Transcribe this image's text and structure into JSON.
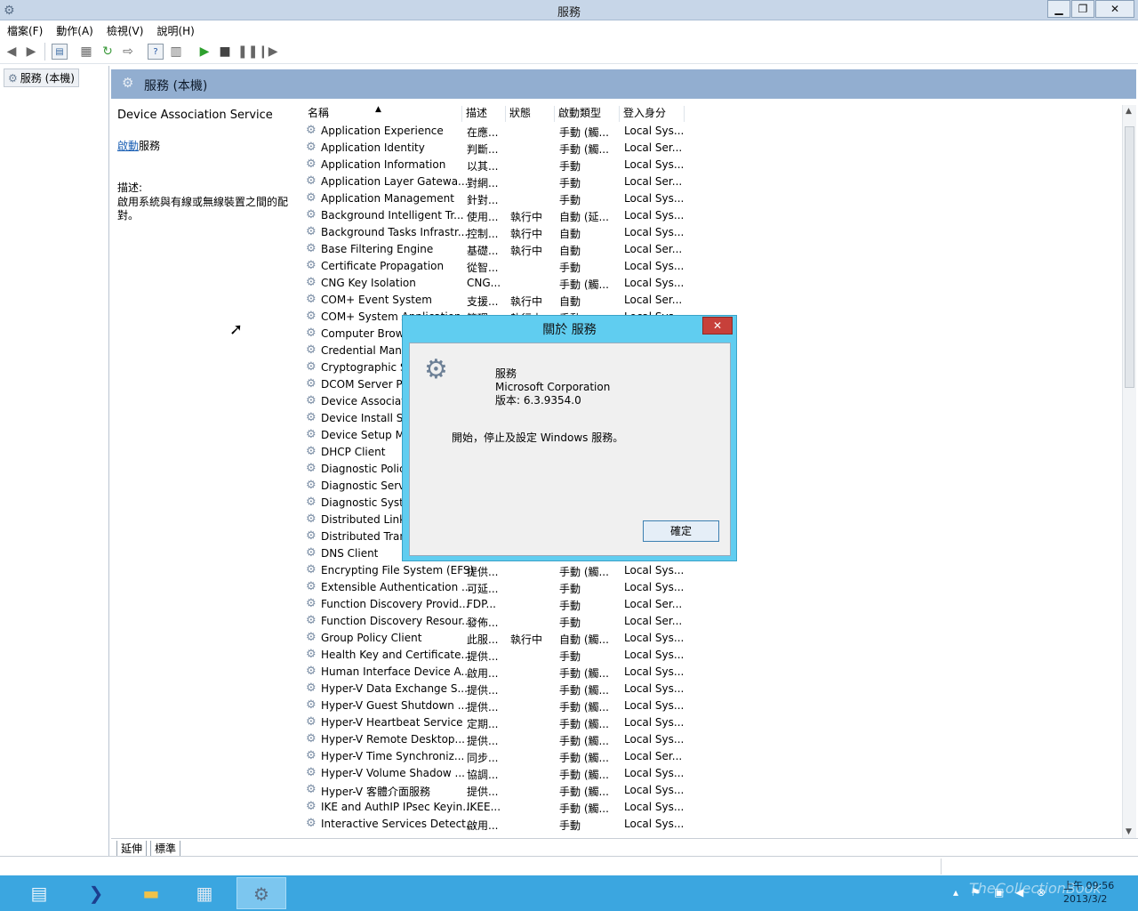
{
  "window": {
    "title": "服務",
    "minimize": "▁",
    "restore": "❐",
    "close": "✕"
  },
  "menu": [
    "檔案(F)",
    "動作(A)",
    "檢視(V)",
    "說明(H)"
  ],
  "tree": {
    "root_label": "服務 (本機)"
  },
  "header": {
    "title": "服務 (本機)"
  },
  "details": {
    "service_name": "Device Association Service",
    "start_link": "啟動",
    "start_suffix": "服務",
    "desc_label": "描述:",
    "desc_text": "啟用系統與有線或無線裝置之間的配對。"
  },
  "columns": {
    "name": "名稱",
    "desc": "描述",
    "status": "狀態",
    "startup": "啟動類型",
    "logon": "登入身分"
  },
  "services": [
    {
      "name": "Application Experience",
      "desc": "在應...",
      "status": "",
      "startup": "手動 (觸...",
      "logon": "Local Sys..."
    },
    {
      "name": "Application Identity",
      "desc": "判斷...",
      "status": "",
      "startup": "手動 (觸...",
      "logon": "Local Ser..."
    },
    {
      "name": "Application Information",
      "desc": "以其...",
      "status": "",
      "startup": "手動",
      "logon": "Local Sys..."
    },
    {
      "name": "Application Layer Gatewa...",
      "desc": "對網...",
      "status": "",
      "startup": "手動",
      "logon": "Local Ser..."
    },
    {
      "name": "Application Management",
      "desc": "針對...",
      "status": "",
      "startup": "手動",
      "logon": "Local Sys..."
    },
    {
      "name": "Background Intelligent Tr...",
      "desc": "使用...",
      "status": "執行中",
      "startup": "自動 (延...",
      "logon": "Local Sys..."
    },
    {
      "name": "Background Tasks Infrastr...",
      "desc": "控制...",
      "status": "執行中",
      "startup": "自動",
      "logon": "Local Sys..."
    },
    {
      "name": "Base Filtering Engine",
      "desc": "基礎...",
      "status": "執行中",
      "startup": "自動",
      "logon": "Local Ser..."
    },
    {
      "name": "Certificate Propagation",
      "desc": "從智...",
      "status": "",
      "startup": "手動",
      "logon": "Local Sys..."
    },
    {
      "name": "CNG Key Isolation",
      "desc": "CNG...",
      "status": "",
      "startup": "手動 (觸...",
      "logon": "Local Sys..."
    },
    {
      "name": "COM+ Event System",
      "desc": "支援...",
      "status": "執行中",
      "startup": "自動",
      "logon": "Local Ser..."
    },
    {
      "name": "COM+ System Application",
      "desc": "管理...",
      "status": "執行中",
      "startup": "手動",
      "logon": "Local Sys..."
    },
    {
      "name": "Computer Browser",
      "desc": "",
      "status": "",
      "startup": "",
      "logon": ""
    },
    {
      "name": "Credential Manager",
      "desc": "",
      "status": "",
      "startup": "",
      "logon": ""
    },
    {
      "name": "Cryptographic Services",
      "desc": "",
      "status": "",
      "startup": "",
      "logon": ""
    },
    {
      "name": "DCOM Server Process Launcher",
      "desc": "",
      "status": "",
      "startup": "",
      "logon": ""
    },
    {
      "name": "Device Association Service",
      "desc": "",
      "status": "",
      "startup": "",
      "logon": ""
    },
    {
      "name": "Device Install Service",
      "desc": "",
      "status": "",
      "startup": "",
      "logon": ""
    },
    {
      "name": "Device Setup Manager",
      "desc": "",
      "status": "",
      "startup": "",
      "logon": ""
    },
    {
      "name": "DHCP Client",
      "desc": "",
      "status": "",
      "startup": "",
      "logon": ""
    },
    {
      "name": "Diagnostic Policy Service",
      "desc": "",
      "status": "",
      "startup": "",
      "logon": ""
    },
    {
      "name": "Diagnostic Service Host",
      "desc": "",
      "status": "",
      "startup": "",
      "logon": ""
    },
    {
      "name": "Diagnostic System Host",
      "desc": "",
      "status": "",
      "startup": "",
      "logon": ""
    },
    {
      "name": "Distributed Link Tracking Client",
      "desc": "",
      "status": "",
      "startup": "",
      "logon": ""
    },
    {
      "name": "Distributed Transaction Coordinator",
      "desc": "",
      "status": "",
      "startup": "",
      "logon": ""
    },
    {
      "name": "DNS Client",
      "desc": "",
      "status": "",
      "startup": "",
      "logon": ""
    },
    {
      "name": "Encrypting File System (EFS)",
      "desc": "提供...",
      "status": "",
      "startup": "手動 (觸...",
      "logon": "Local Sys..."
    },
    {
      "name": "Extensible Authentication ...",
      "desc": "可延...",
      "status": "",
      "startup": "手動",
      "logon": "Local Sys..."
    },
    {
      "name": "Function Discovery Provid...",
      "desc": "FDP...",
      "status": "",
      "startup": "手動",
      "logon": "Local Ser..."
    },
    {
      "name": "Function Discovery Resour...",
      "desc": "發佈...",
      "status": "",
      "startup": "手動",
      "logon": "Local Ser..."
    },
    {
      "name": "Group Policy Client",
      "desc": "此服...",
      "status": "執行中",
      "startup": "自動 (觸...",
      "logon": "Local Sys..."
    },
    {
      "name": "Health Key and Certificate...",
      "desc": "提供...",
      "status": "",
      "startup": "手動",
      "logon": "Local Sys..."
    },
    {
      "name": "Human Interface Device A...",
      "desc": "啟用...",
      "status": "",
      "startup": "手動 (觸...",
      "logon": "Local Sys..."
    },
    {
      "name": "Hyper-V Data Exchange S...",
      "desc": "提供...",
      "status": "",
      "startup": "手動 (觸...",
      "logon": "Local Sys..."
    },
    {
      "name": "Hyper-V Guest Shutdown ...",
      "desc": "提供...",
      "status": "",
      "startup": "手動 (觸...",
      "logon": "Local Sys..."
    },
    {
      "name": "Hyper-V Heartbeat Service",
      "desc": "定期...",
      "status": "",
      "startup": "手動 (觸...",
      "logon": "Local Sys..."
    },
    {
      "name": "Hyper-V Remote Desktop...",
      "desc": "提供...",
      "status": "",
      "startup": "手動 (觸...",
      "logon": "Local Sys..."
    },
    {
      "name": "Hyper-V Time Synchroniz...",
      "desc": "同步...",
      "status": "",
      "startup": "手動 (觸...",
      "logon": "Local Ser..."
    },
    {
      "name": "Hyper-V Volume Shadow ...",
      "desc": "協調...",
      "status": "",
      "startup": "手動 (觸...",
      "logon": "Local Sys..."
    },
    {
      "name": "Hyper-V 客體介面服務",
      "desc": "提供...",
      "status": "",
      "startup": "手動 (觸...",
      "logon": "Local Sys..."
    },
    {
      "name": "IKE and AuthIP IPsec Keyin...",
      "desc": "IKEE...",
      "status": "",
      "startup": "手動 (觸...",
      "logon": "Local Sys..."
    },
    {
      "name": "Interactive Services Detect...",
      "desc": "啟用...",
      "status": "",
      "startup": "手動",
      "logon": "Local Sys..."
    }
  ],
  "tabs": [
    "延伸",
    "標準"
  ],
  "dialog": {
    "title": "關於 服務",
    "close": "✕",
    "product": "服務",
    "company": "Microsoft Corporation",
    "version": "版本: 6.3.9354.0",
    "message": "開始，停止及設定 Windows 服務。",
    "ok": "確定"
  },
  "clock": {
    "time": "上午 09:56",
    "date": "2013/3/2"
  },
  "watermark": "TheCollectionBook"
}
